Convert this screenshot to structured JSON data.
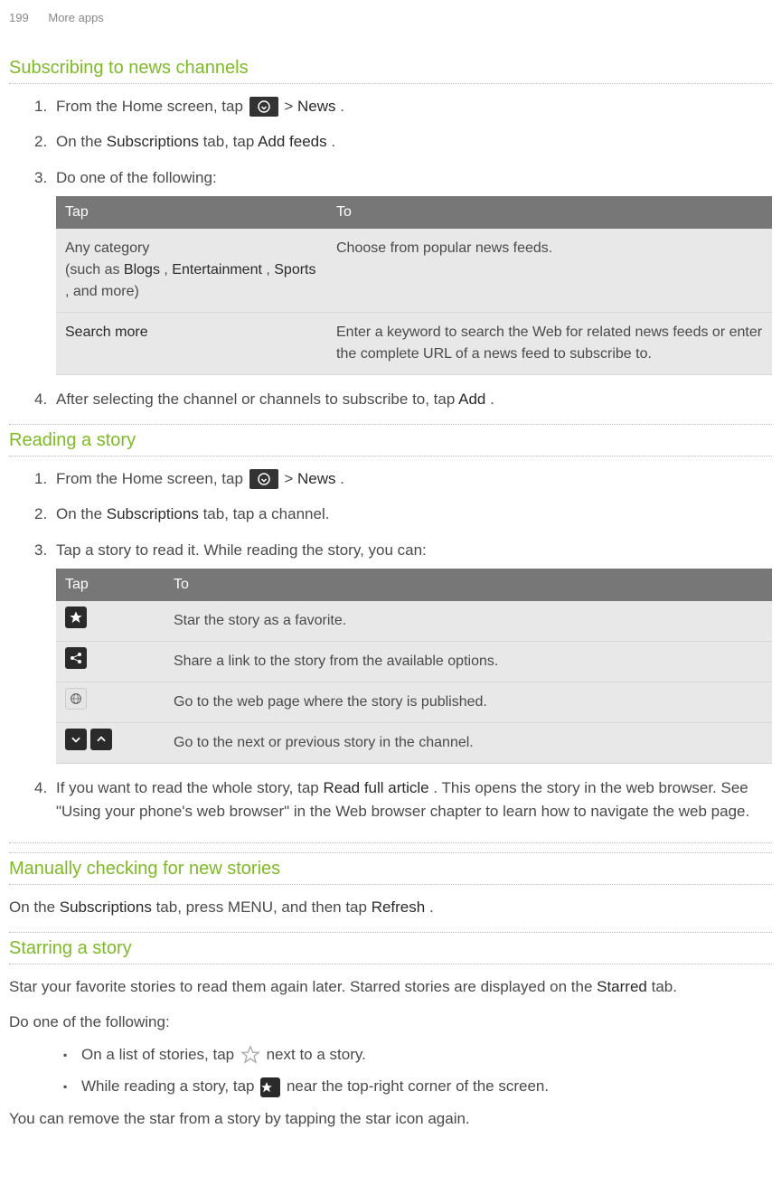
{
  "header": {
    "page": "199",
    "section": "More apps"
  },
  "s1": {
    "title": "Subscribing to news channels",
    "steps": {
      "n1a": "From the Home screen, tap ",
      "n1b": " > ",
      "n1c": "News",
      "n1d": ".",
      "n2a": "On the ",
      "n2b": "Subscriptions",
      "n2c": " tab, tap ",
      "n2d": "Add feeds",
      "n2e": ".",
      "n3": "Do one of the following:",
      "n4a": "After selecting the channel or channels to subscribe to, tap ",
      "n4b": "Add",
      "n4c": "."
    },
    "table": {
      "h1": "Tap",
      "h2": "To",
      "r1c1a": "Any category",
      "r1c1b": "(such as ",
      "r1c1c": "Blogs",
      "r1c1d": ", ",
      "r1c1e": "Entertainment",
      "r1c1f": ", ",
      "r1c1g": "Sports",
      "r1c1h": ", and more)",
      "r1c2": "Choose from popular news feeds.",
      "r2c1": "Search more",
      "r2c2": "Enter a keyword to search the Web for related news feeds or enter the complete URL of a news feed to subscribe to."
    }
  },
  "s2": {
    "title": "Reading a story",
    "steps": {
      "n1a": "From the Home screen, tap ",
      "n1b": " > ",
      "n1c": "News",
      "n1d": ".",
      "n2a": "On the ",
      "n2b": "Subscriptions",
      "n2c": " tab, tap a channel.",
      "n3": "Tap a story to read it. While reading the story, you can:",
      "n4a": "If you want to read the whole story, tap ",
      "n4b": "Read full article",
      "n4c": ". This opens the story in the web browser. See \"Using your phone's web browser\" in the Web browser chapter to learn how to navigate the web page."
    },
    "table": {
      "h1": "Tap",
      "h2": "To",
      "r1": "Star the story as a favorite.",
      "r2": "Share a link to the story from the available options.",
      "r3": "Go to the web page where the story is published.",
      "r4": "Go to the next or previous story in the channel."
    }
  },
  "s3": {
    "title": "Manually checking for new stories",
    "p1a": "On the ",
    "p1b": "Subscriptions",
    "p1c": " tab, press MENU, and then tap ",
    "p1d": "Refresh",
    "p1e": "."
  },
  "s4": {
    "title": "Starring a story",
    "p1a": "Star your favorite stories to read them again later. Starred stories are displayed on the ",
    "p1b": "Starred",
    "p1c": " tab.",
    "p2": "Do one of the following:",
    "b1a": "On a list of stories, tap ",
    "b1b": " next to a story.",
    "b2a": "While reading a story, tap ",
    "b2b": " near the top-right corner of the screen.",
    "p3": "You can remove the star from a story by tapping the star icon again."
  },
  "nums": {
    "1": "1.",
    "2": "2.",
    "3": "3.",
    "4": "4."
  }
}
